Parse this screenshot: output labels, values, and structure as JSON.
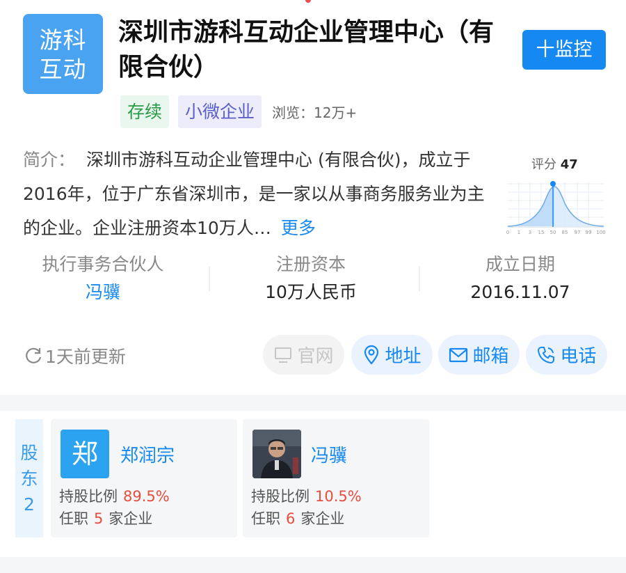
{
  "company": {
    "logo_lines": [
      "游科",
      "互动"
    ],
    "title": "深圳市游科互动企业管理中心（有限合伙）",
    "monitor_label": "十监控",
    "tags": [
      "存续",
      "小微企业"
    ],
    "views": "浏览：12万+",
    "intro_label": "简介：",
    "intro_text": "深圳市游科互动企业管理中心 (有限合伙)，成立于2016年，位于广东省深圳市，是一家以从事商务服务业为主的企业。企业注册资本10万人…",
    "intro_more": "更多",
    "score_label": "评分",
    "score_value": "47",
    "score_ticks": [
      "0",
      "1",
      "3",
      "15",
      "50",
      "85",
      "97",
      "99",
      "100"
    ]
  },
  "stats": [
    {
      "key": "执行事务合伙人",
      "value": "冯骥"
    },
    {
      "key": "注册资本",
      "value": "10万人民币"
    },
    {
      "key": "成立日期",
      "value": "2016.11.07"
    }
  ],
  "actions": {
    "update_text": "1天前更新",
    "website": "官网",
    "address": "地址",
    "email": "邮箱",
    "phone": "电话"
  },
  "shareholders": {
    "label_chars": [
      "股",
      "东",
      "2"
    ],
    "cards": [
      {
        "avatar_text": "郑",
        "name": "郑润宗",
        "share_label": "持股比例",
        "share": "89.5%",
        "job_prefix": "任职",
        "job_count": "5",
        "job_suffix": "家企业"
      },
      {
        "avatar_text": "",
        "name": "冯骥",
        "share_label": "持股比例",
        "share": "10.5%",
        "job_prefix": "任职",
        "job_count": "6",
        "job_suffix": "家企业"
      }
    ]
  },
  "colors": {
    "accent": "#1688f2",
    "logo": "#4aa3f1",
    "highlight": "#e84c3d"
  }
}
